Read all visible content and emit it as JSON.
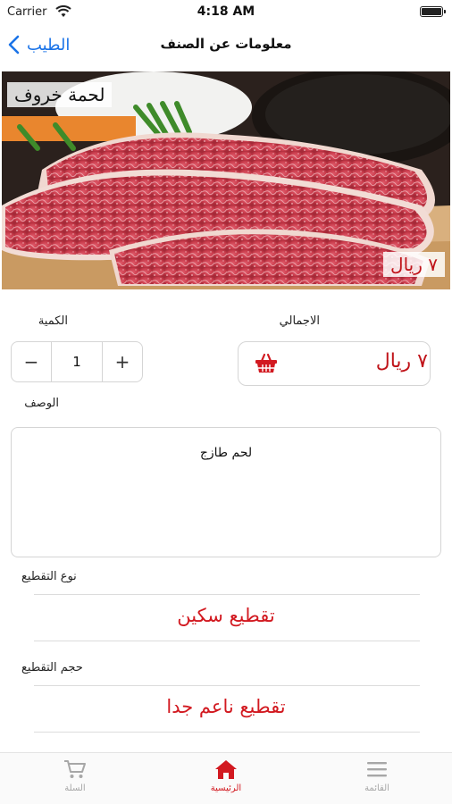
{
  "status": {
    "carrier": "Carrier",
    "time": "4:18 AM"
  },
  "nav": {
    "back_label": "الطيب",
    "title": "معلومات عن الصنف"
  },
  "hero": {
    "name_overlay": "لحمة خروف",
    "price_overlay": "٧ ريال"
  },
  "quantity": {
    "label": "الكمية",
    "minus": "−",
    "plus": "+",
    "value": "1"
  },
  "total": {
    "label": "الاجمالي",
    "value": "٧ ريال"
  },
  "description": {
    "label": "الوصف",
    "text": "لحم طازج"
  },
  "cut_type": {
    "label": "نوع التقطيع",
    "value": "تقطيع سكين"
  },
  "cut_size": {
    "label": "حجم التقطيع",
    "value": "تقطيع ناعم جدا"
  },
  "tabs": [
    {
      "label": "السلة",
      "icon": "cart-icon",
      "active": false
    },
    {
      "label": "الرئيسية",
      "icon": "home-icon",
      "active": true
    },
    {
      "label": "القائمة",
      "icon": "menu-icon",
      "active": false
    }
  ],
  "colors": {
    "accent_red": "#d21920",
    "link_blue": "#1a73e8",
    "inactive_gray": "#a7a7a7"
  }
}
